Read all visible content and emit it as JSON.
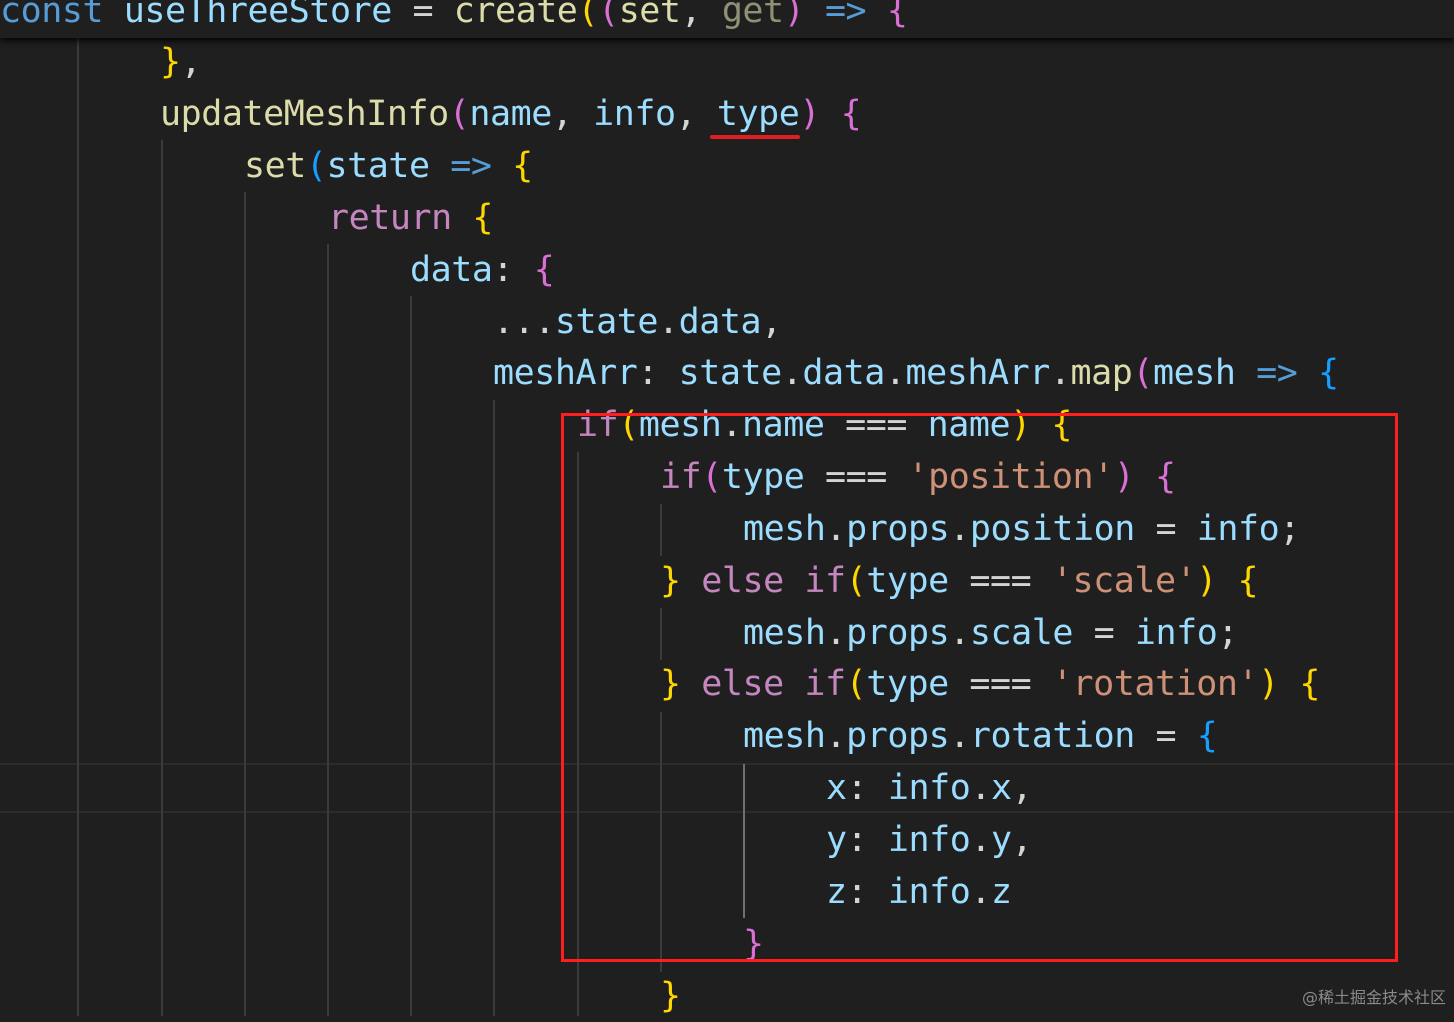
{
  "editor": {
    "sticky_line": {
      "text": "const useThreeStore = create((set, get) => {"
    },
    "lines": [
      {
        "text": "},"
      },
      {
        "text": "updateMeshInfo(name, info, type) {"
      },
      {
        "text": "set(state => {"
      },
      {
        "text": "return {"
      },
      {
        "text": "data: {"
      },
      {
        "text": "...state.data,"
      },
      {
        "text": "meshArr: state.data.meshArr.map(mesh => {"
      },
      {
        "text": "if(mesh.name === name) {"
      },
      {
        "text": "if(type === 'position') {"
      },
      {
        "text": "mesh.props.position = info;"
      },
      {
        "text": "} else if(type === 'scale') {"
      },
      {
        "text": "mesh.props.scale = info;"
      },
      {
        "text": "} else if(type === 'rotation') {"
      },
      {
        "text": "mesh.props.rotation = {"
      },
      {
        "text": "x: info.x,"
      },
      {
        "text": "y: info.y,"
      },
      {
        "text": "z: info.z"
      },
      {
        "text": "}"
      },
      {
        "text": "}"
      }
    ]
  },
  "annotations": {
    "underline_color": "#e02020",
    "box_color": "#ff1e1e"
  },
  "watermark": {
    "text": "@稀土掘金技术社区"
  },
  "colors": {
    "background": "#1f1f1f",
    "keyword": "#569cd6",
    "function": "#dcdcaa",
    "variable": "#9cdcfe",
    "control": "#c586c0",
    "string": "#ce9178",
    "bracket_gold": "#ffd700",
    "bracket_orchid": "#da70d6",
    "bracket_blue": "#179fff"
  }
}
